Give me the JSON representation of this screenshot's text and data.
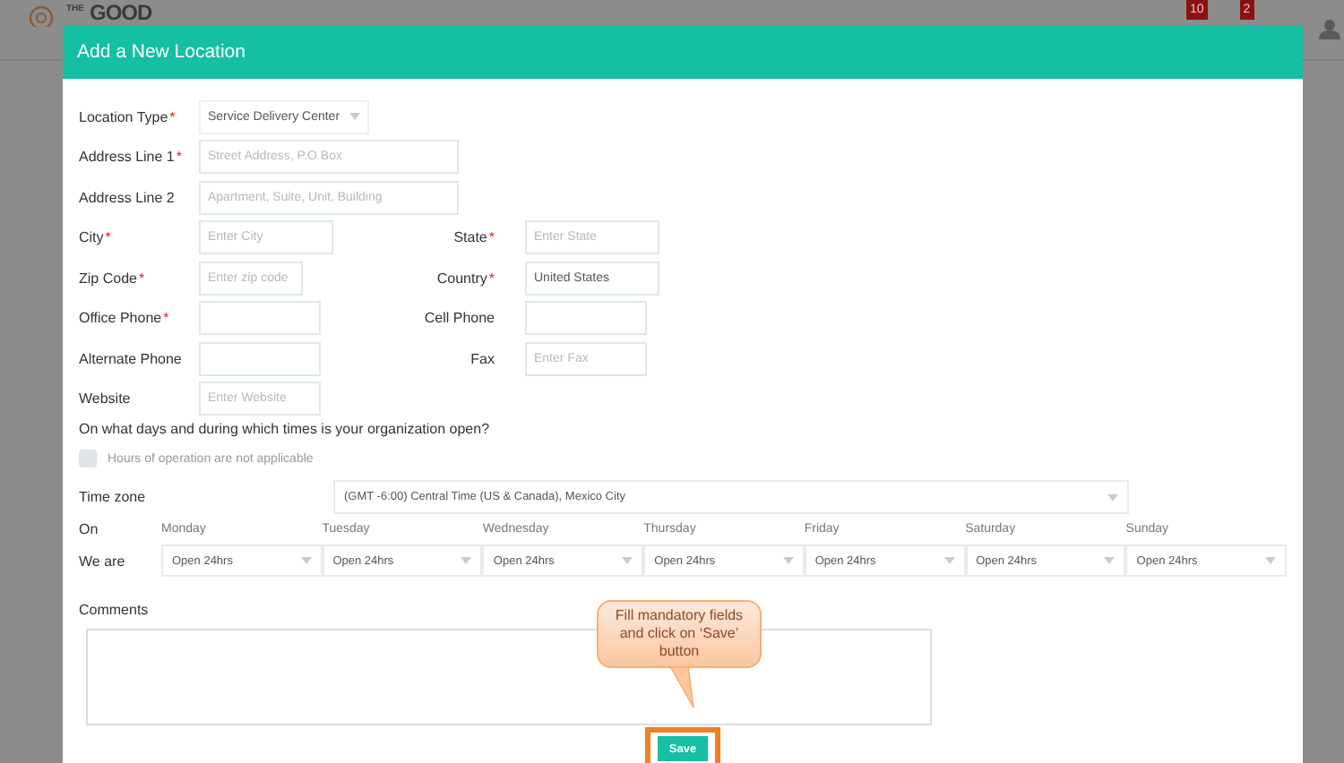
{
  "background": {
    "logo": {
      "small": "THE",
      "large": "GOOD"
    },
    "badges": [
      {
        "count": "10"
      },
      {
        "count": "2"
      }
    ]
  },
  "modal": {
    "title": "Add a New Location",
    "rows": [
      [
        {
          "kind": "select",
          "label": "Location Type",
          "required_mark": "*",
          "value": "Service Delivery Center"
        }
      ],
      [
        {
          "kind": "text",
          "label": "Address Line 1",
          "required_mark": "*",
          "placeholder": "Street Address, P.O Box"
        }
      ],
      [
        {
          "kind": "text",
          "label": "Address Line 2",
          "placeholder": "Apartment, Suite, Unit, Building"
        }
      ],
      [
        {
          "kind": "text",
          "label": "City",
          "required_mark": "*",
          "placeholder": "Enter City"
        },
        {
          "kind": "text",
          "label": "State",
          "required_mark": "*",
          "placeholder": "Enter State"
        }
      ],
      [
        {
          "kind": "text",
          "label": "Zip Code",
          "required_mark": "*",
          "placeholder": "Enter zip code"
        },
        {
          "kind": "text",
          "label": "Country",
          "required_mark": "*",
          "value": "United States"
        }
      ],
      [
        {
          "kind": "text",
          "label": "Office Phone",
          "required_mark": "*"
        },
        {
          "kind": "text",
          "label": "Cell Phone"
        }
      ],
      [
        {
          "kind": "text",
          "label": "Alternate Phone"
        },
        {
          "kind": "text",
          "label": "Fax",
          "placeholder": "Enter Fax"
        }
      ],
      [
        {
          "kind": "text",
          "label": "Website",
          "placeholder": "Enter Website"
        }
      ]
    ],
    "hours": {
      "question": "On what days and during which times is your organization open?",
      "not_applicable": {
        "label": "Hours of operation are not applicable",
        "checked": false
      },
      "time_zone": {
        "label": "Time zone",
        "value": "(GMT -6:00) Central Time (US & Canada), Mexico City"
      },
      "on_label": "On",
      "we_are_label": "We are",
      "days": [
        {
          "day": "Monday",
          "value": "Open 24hrs"
        },
        {
          "day": "Tuesday",
          "value": "Open 24hrs"
        },
        {
          "day": "Wednesday",
          "value": "Open 24hrs"
        },
        {
          "day": "Thursday",
          "value": "Open 24hrs"
        },
        {
          "day": "Friday",
          "value": "Open 24hrs"
        },
        {
          "day": "Saturday",
          "value": "Open 24hrs"
        },
        {
          "day": "Sunday",
          "value": "Open 24hrs"
        }
      ]
    },
    "comments": {
      "label": "Comments"
    },
    "save_button": {
      "label": "Save",
      "highlighted": true
    }
  },
  "callout": {
    "text": "Fill mandatory fields and click on ‘Save’ button"
  }
}
